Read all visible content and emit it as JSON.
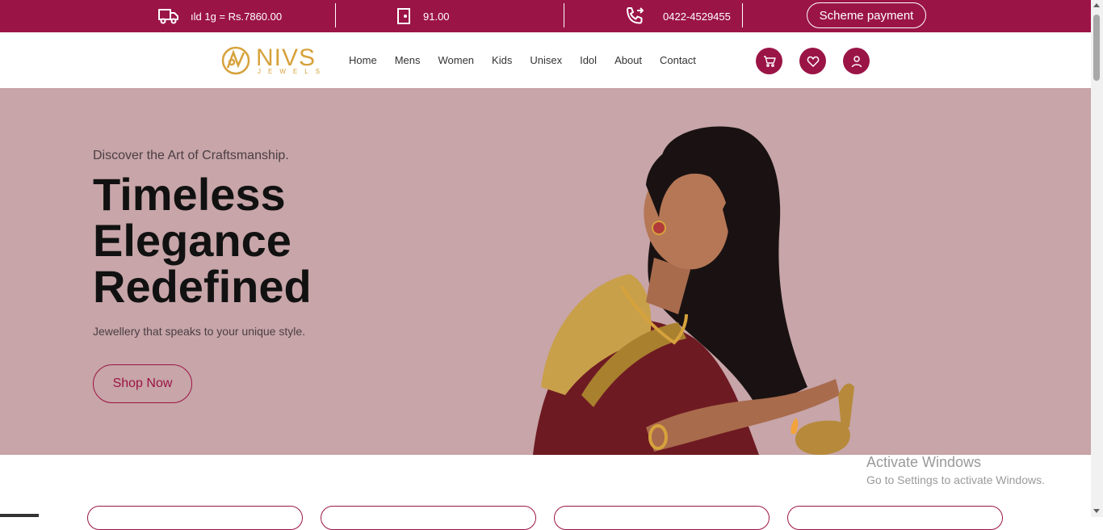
{
  "topbar": {
    "gold_rate": "ıld 1g = Rs.7860.00",
    "silver_rate": "91.00",
    "phone": "0422-4529455",
    "scheme_button": "Scheme payment"
  },
  "header": {
    "logo_text": "NIVS",
    "logo_sub": "JEWELS",
    "nav": [
      "Home",
      "Mens",
      "Women",
      "Kids",
      "Unisex",
      "Idol",
      "About",
      "Contact"
    ]
  },
  "hero": {
    "kicker": "Discover the Art of Craftsmanship.",
    "title_line1": "Timeless",
    "title_line2": "Elegance",
    "title_line3": "Redefined",
    "subtitle": "Jewellery that speaks to your unique style.",
    "cta": "Shop Now"
  },
  "watermark": {
    "line1": "Activate Windows",
    "line2": "Go to Settings to activate Windows."
  },
  "colors": {
    "brand": "#9b1446",
    "hero_bg": "#c7a5a8",
    "gold": "#d6a23c"
  },
  "icons": [
    "truck-icon",
    "door-icon",
    "phone-forward-icon",
    "cart-icon",
    "heart-icon",
    "user-icon"
  ]
}
